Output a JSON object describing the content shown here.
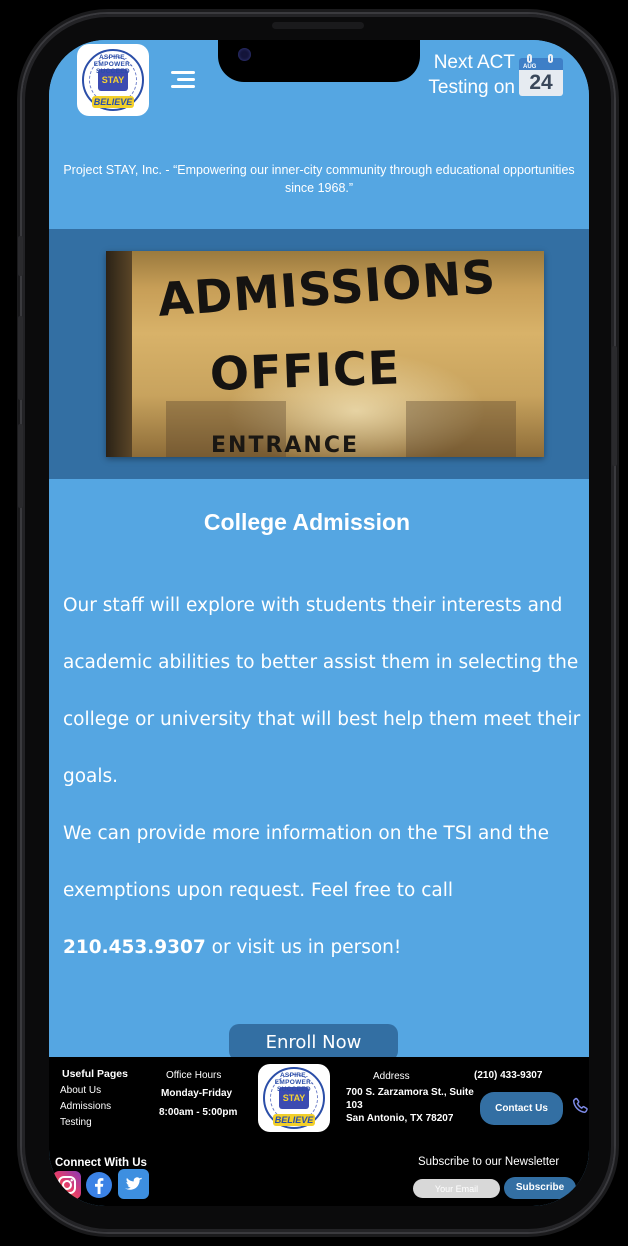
{
  "header": {
    "logo_top_text": "ASPIRE. EMPOWER. SUCCEED",
    "logo_center_text": "STAY",
    "logo_banner_text": "BELIEVE",
    "next_act_line1": "Next ACT",
    "next_act_line2": "Testing on",
    "calendar_month": "AUG",
    "calendar_day": "24",
    "tagline": "Project STAY, Inc. - “Empowering our inner-city community through educational opportunities since 1968.”"
  },
  "hero": {
    "line1": "ADMISSIONS",
    "line2": "OFFICE",
    "line3": "ENTRANCE"
  },
  "content": {
    "title": "College Admission",
    "paragraph1": " Our staff will explore with students their interests and academic abilities to better assist them in selecting the college or university that will best help them meet their goals.",
    "paragraph2_start": "We can provide more information on the TSI and the exemptions upon request. Feel free to call ",
    "phone": "210.453.9307",
    "paragraph2_end": " or visit us in person!",
    "enroll_label": "Enroll Now"
  },
  "footer": {
    "useful_pages_title": "Useful Pages",
    "useful_pages": [
      "About Us",
      "Admissions",
      "Testing"
    ],
    "office_hours_title": "Office Hours",
    "office_days": "Monday-Friday",
    "office_time": "8:00am - 5:00pm",
    "address_title": "Address",
    "address_line1": "700 S. Zarzamora St., Suite",
    "address_line2": "103",
    "address_line3": "San Antonio, TX 78207",
    "phone": "(210) 433-9307",
    "contact_label": "Contact Us",
    "connect_title": "Connect With Us",
    "newsletter_title": "Subscribe to our Newsletter",
    "email_placeholder": "Your Email",
    "subscribe_label": "Subscribe"
  },
  "colors": {
    "primary": "#55a6e2",
    "secondary": "#336fa3",
    "footer_bg": "#000000",
    "accent_yellow": "#f2cf2a"
  },
  "icons": [
    "menu-icon",
    "calendar-icon",
    "phone-icon",
    "instagram-icon",
    "facebook-icon",
    "twitter-icon"
  ]
}
